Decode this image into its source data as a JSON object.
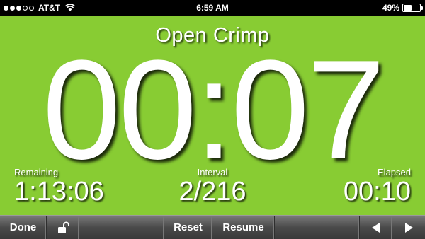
{
  "status_bar": {
    "carrier": "AT&T",
    "time": "6:59 AM",
    "battery_text": "49%",
    "battery_level": 0.49,
    "signal_bars_filled": 3,
    "signal_bars_total": 5
  },
  "timer": {
    "interval_name": "Open Crimp",
    "countdown": "00:07",
    "remaining_label": "Remaining",
    "remaining_value": "1:13:06",
    "interval_label": "Interval",
    "interval_value": "2/216",
    "elapsed_label": "Elapsed",
    "elapsed_value": "00:10",
    "background_color": "#88cc33"
  },
  "toolbar": {
    "done_label": "Done",
    "lock_icon": "unlock-icon",
    "reset_label": "Reset",
    "resume_label": "Resume",
    "prev_icon": "triangle-left-icon",
    "next_icon": "triangle-right-icon"
  }
}
